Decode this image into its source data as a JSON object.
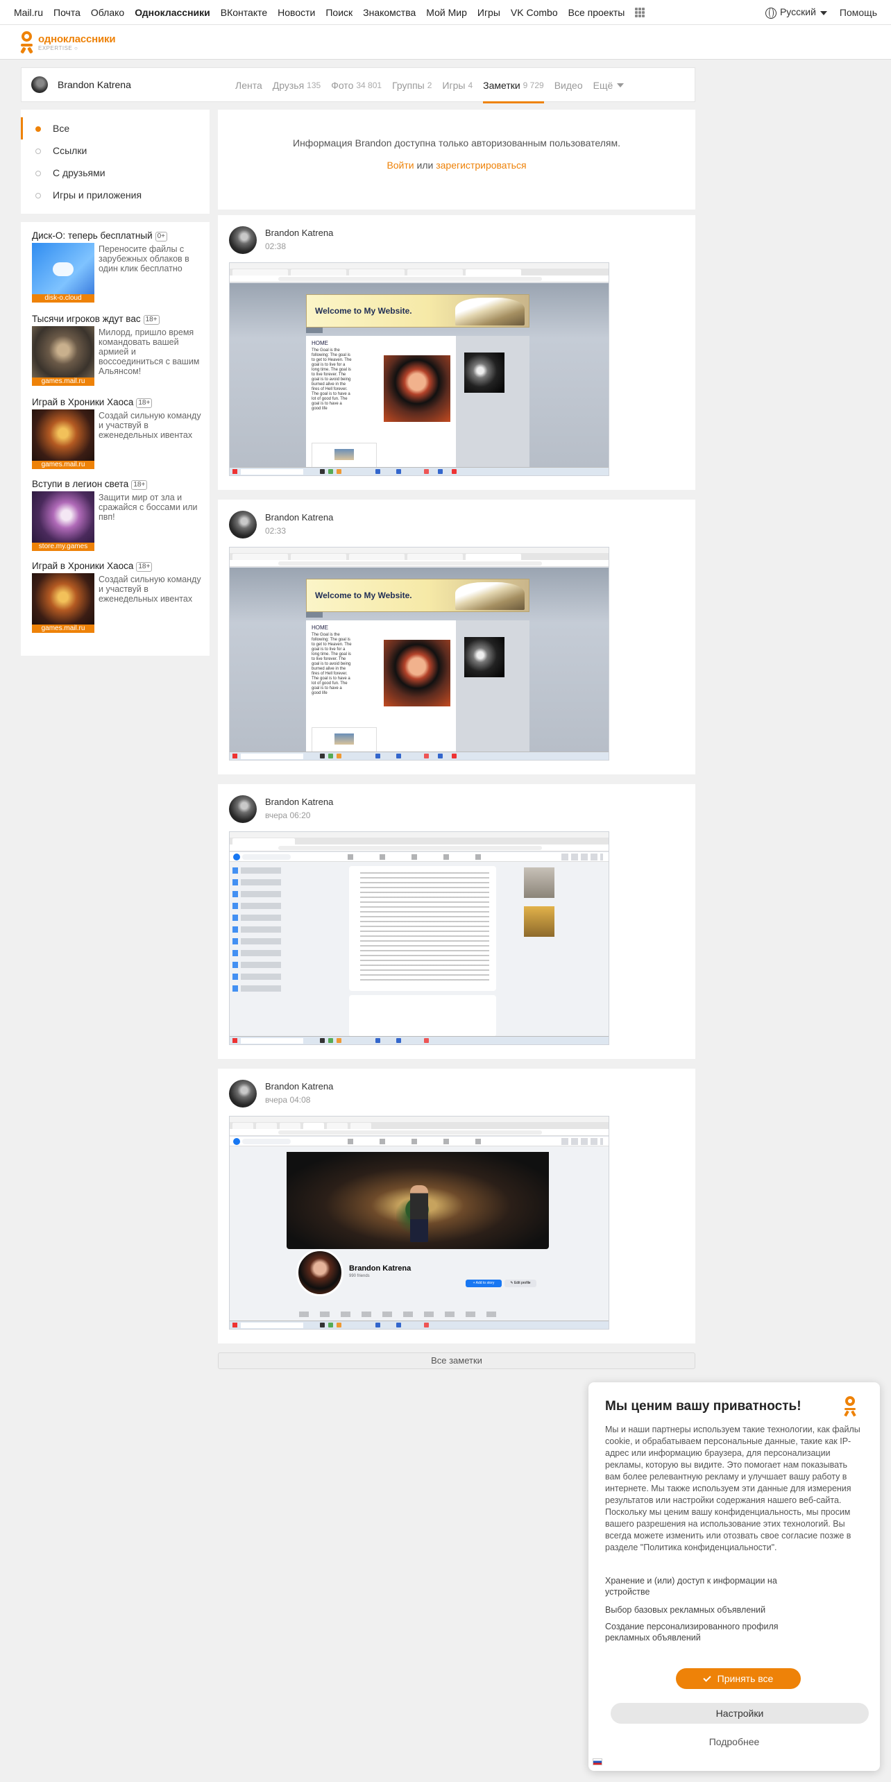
{
  "portal": {
    "links": [
      "Mail.ru",
      "Почта",
      "Облако",
      "Одноклассники",
      "ВКонтакте",
      "Новости",
      "Поиск",
      "Знакомства",
      "Мой Мир",
      "Игры",
      "VK Combo",
      "Все проекты"
    ],
    "active_link": "Одноклассники",
    "language": "Русский",
    "help": "Помощь"
  },
  "logo": {
    "name": "одноклассники",
    "sub": "expertise ○",
    "brand_color": "#ee8208"
  },
  "profile": {
    "name": "Brandon Katrena",
    "tabs": [
      {
        "label": "Лента",
        "count": ""
      },
      {
        "label": "Друзья",
        "count": "135"
      },
      {
        "label": "Фото",
        "count": "34 801"
      },
      {
        "label": "Группы",
        "count": "2"
      },
      {
        "label": "Игры",
        "count": "4"
      },
      {
        "label": "Заметки",
        "count": "9 729"
      },
      {
        "label": "Видео",
        "count": ""
      },
      {
        "label": "Ещё",
        "count": ""
      }
    ],
    "active_tab": "Заметки"
  },
  "left_menu": {
    "items": [
      "Все",
      "Ссылки",
      "С друзьями",
      "Игры и приложения"
    ],
    "active": "Все"
  },
  "ads": [
    {
      "title": "Диск-О: теперь бесплатный",
      "age": "0+",
      "text": "Переносите файлы с зарубежных облаков в один клик бесплатно",
      "caption": "disk-o.cloud"
    },
    {
      "title": "Тысячи игроков ждут вас",
      "age": "18+",
      "text": "Милорд, пришло время командовать вашей армией и воссоединиться с вашим Альянсом!",
      "caption": "games.mail.ru"
    },
    {
      "title": "Играй в Хроники Хаоса",
      "age": "18+",
      "text": "Создай сильную команду и участвуй в еженедельных ивентах",
      "caption": "games.mail.ru"
    },
    {
      "title": "Вступи в легион света",
      "age": "18+",
      "text": "Защити мир от зла и сражайся с боссами или пвп!",
      "caption": "store.my.games"
    },
    {
      "title": "Играй в Хроники Хаоса",
      "age": "18+",
      "text": "Создай сильную команду и участвуй в еженедельных ивентах",
      "caption": "games.mail.ru"
    }
  ],
  "notice": {
    "message": "Информация Brandon доступна только авторизованным пользователям.",
    "login": "Войти",
    "or": "или",
    "register": "зарегистрироваться"
  },
  "posts": [
    {
      "author": "Brandon Katrena",
      "time": "02:38",
      "kind": "website"
    },
    {
      "author": "Brandon Katrena",
      "time": "02:33",
      "kind": "website"
    },
    {
      "author": "Brandon Katrena",
      "time": "вчера 06:20",
      "kind": "facebook-feed"
    },
    {
      "author": "Brandon Katrena",
      "time": "вчера 04:08",
      "kind": "facebook-profile"
    }
  ],
  "screenshot": {
    "site_title": "Welcome to My Website.",
    "site_home": "HOME",
    "site_text": "The Goal is the following: The goal is to get to Heaven. The goal is to live for a long time. The goal is to live forever. The goal is to avoid being burned alive in the fires of Hell forever. The goal is to have a lot of good fun. The goal is to have a good life",
    "fb_name": "Brandon Katrena",
    "fb_friends": "990 friends",
    "fb_add_story": "+ Add to story",
    "fb_edit_profile": "✎ Edit profile"
  },
  "all_notes": "Все заметки",
  "privacy": {
    "title": "Мы ценим вашу приватность!",
    "body": "Мы и наши партнеры используем такие технологии, как файлы cookie, и обрабатываем персональные данные, такие как IP-адрес или информацию браузера, для персонализации рекламы, которую вы видите. Это помогает нам показывать вам более релевантную рекламу и улучшает вашу работу в интернете. Мы также используем эти данные для измерения результатов или настройки содержания нашего веб-сайта. Поскольку мы ценим вашу конфиденциальность, мы просим вашего разрешения на использование этих технологий. Вы всегда можете изменить или отозвать свое согласие позже в разделе \"Политика конфиденциальности\".",
    "options": [
      "Хранение и (или) доступ к информации на устройстве",
      "Выбор базовых рекламных объявлений",
      "Создание персонализированного профиля рекламных объявлений"
    ],
    "accept": "Принять все",
    "settings": "Настройки",
    "more": "Подробнее"
  }
}
